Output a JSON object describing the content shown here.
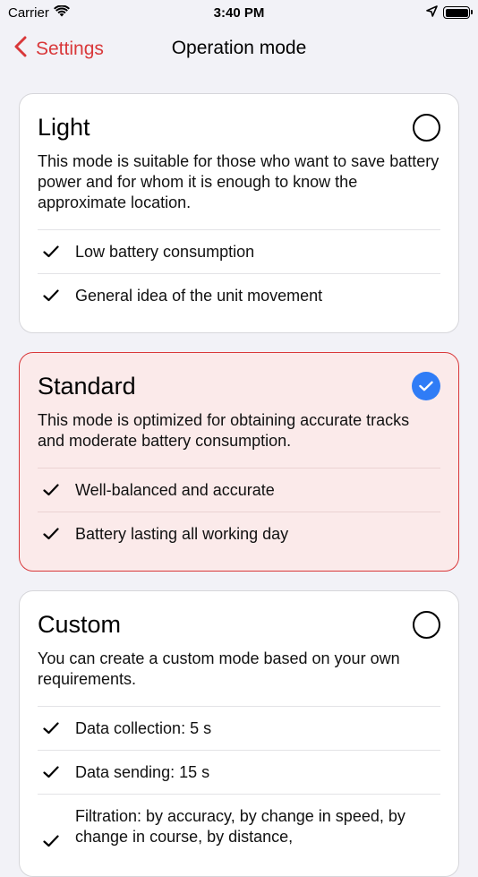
{
  "status": {
    "carrier": "Carrier",
    "time": "3:40 PM"
  },
  "nav": {
    "back_label": "Settings",
    "title": "Operation mode"
  },
  "modes": [
    {
      "title": "Light",
      "description": "This mode is suitable for those who want to save battery power and for whom it is enough to know the approximate location.",
      "selected": false,
      "features": [
        "Low battery consumption",
        "General idea of the unit movement"
      ]
    },
    {
      "title": "Standard",
      "description": "This mode is optimized for obtaining accurate tracks and moderate battery consumption.",
      "selected": true,
      "features": [
        "Well-balanced and accurate",
        "Battery lasting all working day"
      ]
    },
    {
      "title": "Custom",
      "description": "You can create a custom mode based on your own requirements.",
      "selected": false,
      "features": [
        "Data collection: 5 s",
        "Data sending: 15 s",
        "Filtration: by accuracy, by change in speed, by change in course, by distance,"
      ]
    }
  ],
  "colors": {
    "accent": "#d9383a",
    "selected_bg": "#fbeaea",
    "check_blue": "#2f7cf6"
  }
}
